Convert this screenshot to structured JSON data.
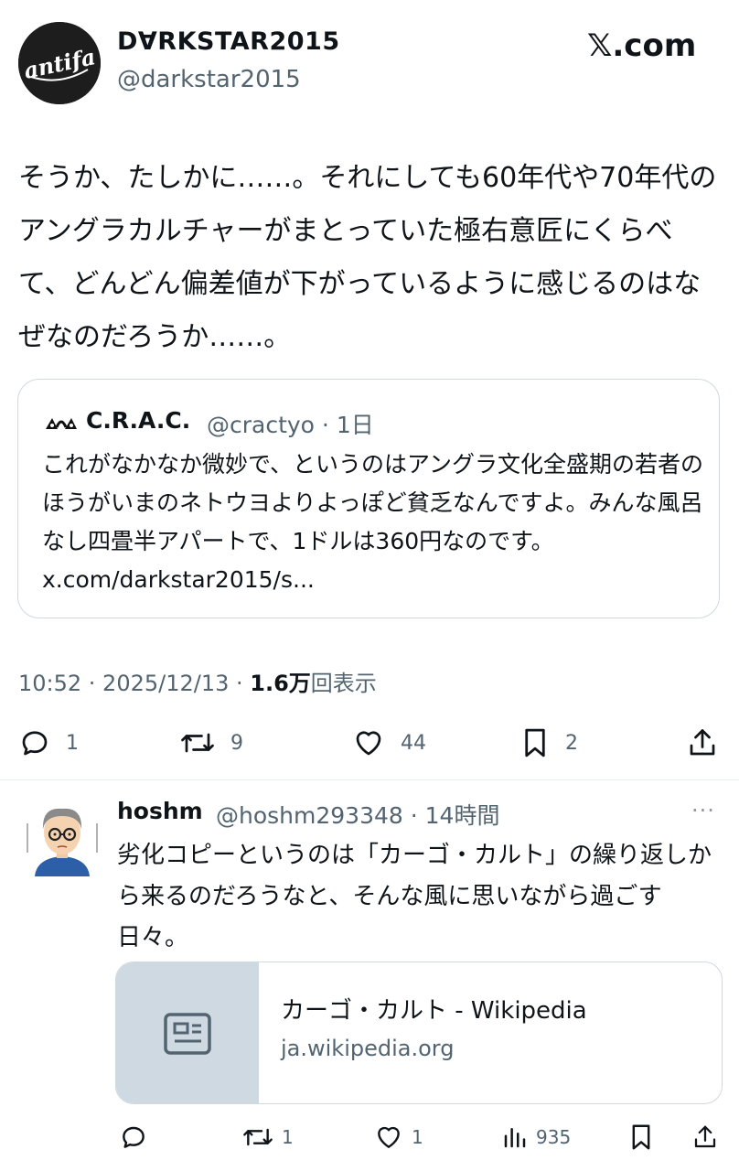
{
  "tweet": {
    "author_name": "D∀RKSTAR2015",
    "author_handle": "@darkstar2015",
    "avatar_text": "antifa",
    "brand": "𝕏.com",
    "text": "そうか、たしかに……。それにしても60年代や70年代のアングラカルチャーがまとっていた極右意匠にくらべて、どんどん偏差値が下がっているように感じるのはなぜなのだろうか……。",
    "quote": {
      "name": "C.R.A.C.",
      "meta": "@cractyo · 1日",
      "text": "これがなかなか微妙で、というのはアングラ文化全盛期の若者のほうがいまのネトウヨよりよっぽど貧乏なんですよ。みんな風呂なし四畳半アパートで、1ドルは360円なのです。 x.com/darkstar2015/s..."
    },
    "timestamp": "10:52 · 2025/12/13 · ",
    "views_count": "1.6万",
    "views_label": "回表示",
    "actions": {
      "replies": "1",
      "retweets": "9",
      "likes": "44",
      "bookmarks": "2"
    }
  },
  "reply": {
    "name": "hoshm",
    "meta": "@hoshm293348 · 14時間",
    "more": "···",
    "text": "劣化コピーというのは「カーゴ・カルト」の繰り返しから来るのだろうなと、そんな風に思いながら過ごす日々。",
    "link_card": {
      "title": "カーゴ・カルト - Wikipedia",
      "domain": "ja.wikipedia.org"
    },
    "actions": {
      "replies": "",
      "retweets": "1",
      "likes": "1",
      "views": "935"
    }
  }
}
